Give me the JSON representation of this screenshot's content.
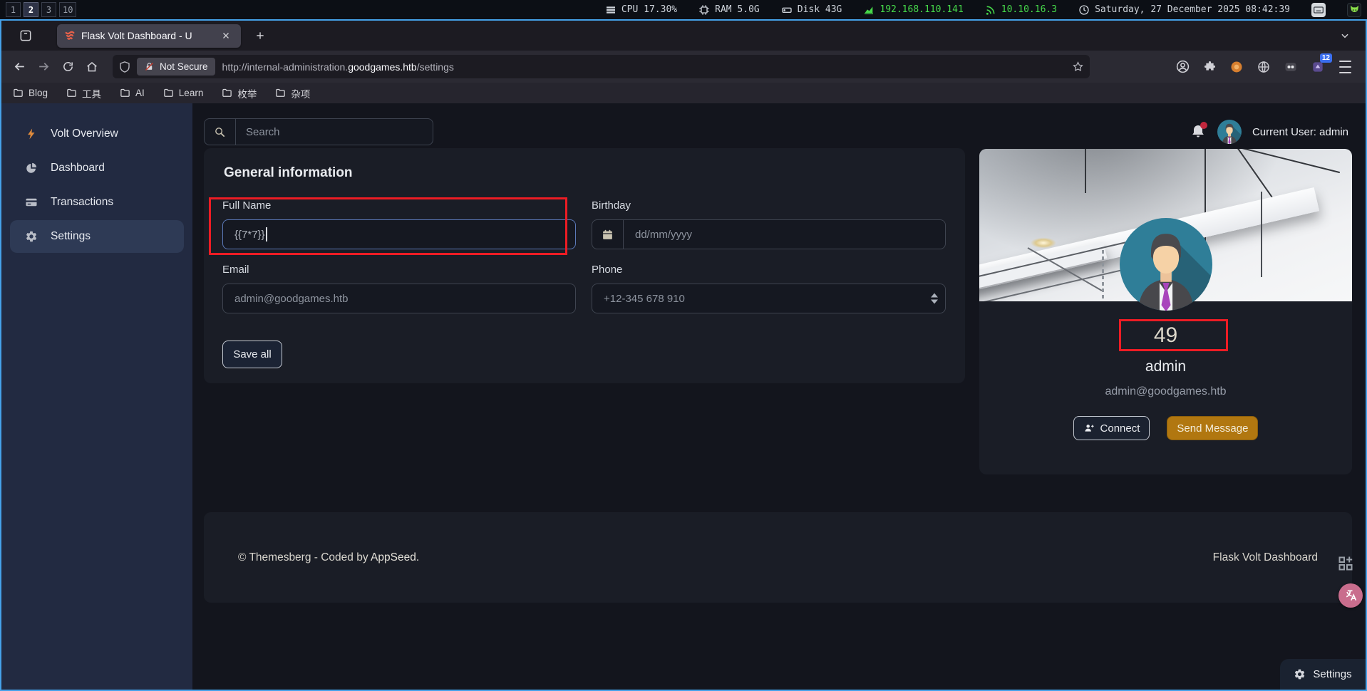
{
  "status_bar": {
    "workspaces": [
      "1",
      "2",
      "3",
      "10"
    ],
    "active_workspace": "2",
    "cpu": "CPU 17.30%",
    "ram": "RAM 5.0G",
    "disk": "Disk 43G",
    "ip_lan": "192.168.110.141",
    "ip_vpn": "10.10.16.3",
    "datetime": "Saturday, 27 December 2025 08:42:39"
  },
  "browser": {
    "tab_title": "Flask Volt Dashboard - U",
    "not_secure_label": "Not Secure",
    "url": {
      "scheme": "http://",
      "host_prefix": "internal-administration.",
      "host_main": "goodgames.htb",
      "path": "/settings"
    },
    "extension_badge": "12",
    "bookmarks": [
      "Blog",
      "工具",
      "AI",
      "Learn",
      "枚举",
      "杂项"
    ]
  },
  "sidebar": {
    "items": [
      {
        "label": "Volt Overview",
        "icon": "bolt-icon"
      },
      {
        "label": "Dashboard",
        "icon": "pie-chart-icon"
      },
      {
        "label": "Transactions",
        "icon": "credit-card-icon"
      },
      {
        "label": "Settings",
        "icon": "gear-icon",
        "active": true
      }
    ]
  },
  "topbar": {
    "search_placeholder": "Search",
    "current_user": "Current User: admin",
    "bell_icon": "bell-icon"
  },
  "general_form": {
    "title": "General information",
    "full_name_label": "Full Name",
    "full_name_value": "{{7*7}}",
    "birthday_label": "Birthday",
    "birthday_placeholder": "dd/mm/yyyy",
    "email_label": "Email",
    "email_value": "admin@goodgames.htb",
    "phone_label": "Phone",
    "phone_placeholder": "+12-345 678 910",
    "save_button": "Save all"
  },
  "profile": {
    "ssti_result": "49",
    "username": "admin",
    "email": "admin@goodgames.htb",
    "connect_button": "Connect",
    "send_message_button": "Send Message"
  },
  "footer": {
    "copyright": "© Themesberg - Coded by ",
    "appseed_link": "AppSeed.",
    "brand": "Flask Volt Dashboard",
    "settings_button": "Settings"
  },
  "colors": {
    "annotation_red": "#ed1c24",
    "window_border_blue": "#45a1e8",
    "send_button_amber": "#b17710",
    "status_green": "#46d94a",
    "sidebar_navy": "#222a41"
  }
}
